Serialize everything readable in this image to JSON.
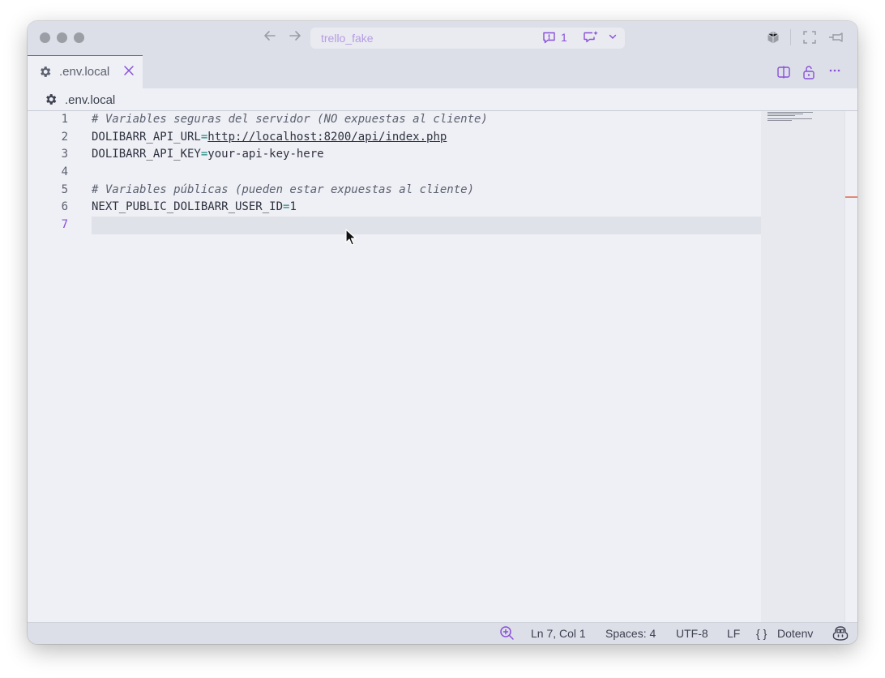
{
  "titlebar": {
    "project_name": "trello_fake",
    "chat_count": "1"
  },
  "tabs": [
    {
      "label": ".env.local",
      "active": true
    }
  ],
  "breadcrumb": {
    "file": ".env.local"
  },
  "editor": {
    "line_numbers": [
      "1",
      "2",
      "3",
      "4",
      "5",
      "6",
      "7"
    ],
    "active_line": 7,
    "lines": [
      {
        "comment": "# Variables seguras del servidor (NO expuestas al cliente)"
      },
      {
        "key": "DOLIBARR_API_URL",
        "eq": "=",
        "value": "http://localhost:8200/api/index.php"
      },
      {
        "key": "DOLIBARR_API_KEY",
        "eq": "=",
        "value": "your-api-key-here"
      },
      {
        "blank": ""
      },
      {
        "comment": "# Variables públicas (pueden estar expuestas al cliente)"
      },
      {
        "key": "NEXT_PUBLIC_DOLIBARR_USER_ID",
        "eq": "=",
        "value": "1"
      },
      {
        "blank": ""
      }
    ]
  },
  "statusbar": {
    "position": "Ln 7, Col 1",
    "indent": "Spaces: 4",
    "encoding": "UTF-8",
    "eol": "LF",
    "language_braces": "{ }",
    "language": "Dotenv"
  },
  "colors": {
    "accent": "#8a4fd8",
    "editor_bg": "#eef0f5",
    "chrome_bg": "#dcdfe8",
    "comment": "#5d6070",
    "operator": "#1f8a84",
    "scroll_marker": "#e08a74"
  },
  "icons": {
    "window_controls": [
      "close-traffic-light",
      "minimize-traffic-light",
      "zoom-traffic-light"
    ],
    "title_left": [
      "back-arrow-icon",
      "forward-arrow-icon"
    ],
    "title_right": [
      "cube-icon",
      "fullscreen-icon",
      "pin-icon"
    ],
    "tab_actions": [
      "split-editor-icon",
      "unlock-icon",
      "more-icon"
    ],
    "status": [
      "zoom-icon",
      "copilot-icon"
    ]
  }
}
